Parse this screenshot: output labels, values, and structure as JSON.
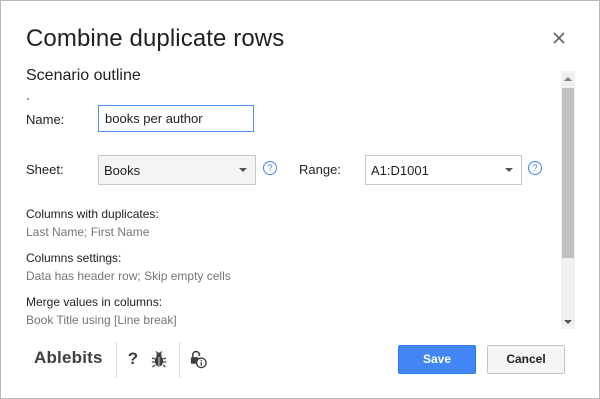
{
  "dialog": {
    "title": "Combine duplicate rows"
  },
  "section": {
    "title": "Scenario outline"
  },
  "form": {
    "name_label": "Name:",
    "name_value": "books per author",
    "sheet_label": "Sheet:",
    "sheet_value": "Books",
    "range_label": "Range:",
    "range_value": "A1:D1001",
    "help_glyph": "?"
  },
  "summary": [
    {
      "label": "Columns with duplicates:",
      "value": "Last Name; First Name"
    },
    {
      "label": "Columns settings:",
      "value": "Data has header row; Skip empty cells"
    },
    {
      "label": "Merge values in columns:",
      "value": "Book Title using [Line break]"
    }
  ],
  "footer": {
    "brand": "Ablebits",
    "help_glyph": "?",
    "icons": [
      "help-icon",
      "bug-icon",
      "privacy-info-icon"
    ],
    "save_label": "Save",
    "cancel_label": "Cancel"
  },
  "colors": {
    "primary": "#4285f4",
    "border_focus": "#4d90fe"
  }
}
